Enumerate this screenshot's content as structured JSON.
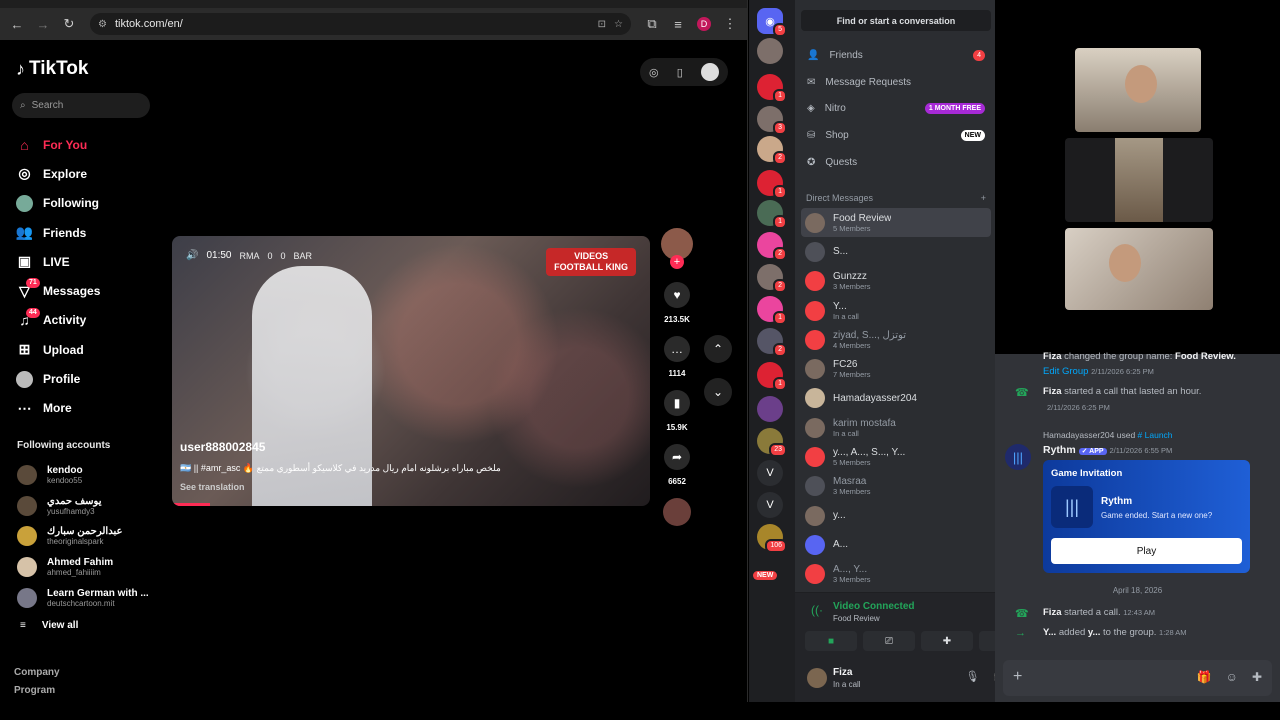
{
  "browser": {
    "url": "tiktok.com/en/",
    "profile_initial": "D"
  },
  "tiktok": {
    "logo": "TikTok",
    "search_placeholder": "Search",
    "nav": [
      {
        "label": "For You",
        "icon": "home-icon",
        "active": true
      },
      {
        "label": "Explore",
        "icon": "compass-icon"
      },
      {
        "label": "Following",
        "icon": "avatar-icon"
      },
      {
        "label": "Friends",
        "icon": "friends-icon"
      },
      {
        "label": "LIVE",
        "icon": "live-icon"
      },
      {
        "label": "Messages",
        "icon": "messages-icon",
        "badge": "71"
      },
      {
        "label": "Activity",
        "icon": "activity-icon",
        "badge": "44"
      },
      {
        "label": "Upload",
        "icon": "upload-icon"
      },
      {
        "label": "Profile",
        "icon": "profile-icon"
      },
      {
        "label": "More",
        "icon": "more-icon"
      }
    ],
    "following_title": "Following accounts",
    "following": [
      {
        "name": "kendoo",
        "user": "kendoo55"
      },
      {
        "name": "يوسف حمدي",
        "user": "yusufhamdy3"
      },
      {
        "name": "عبدالرحمن سبارك",
        "user": "theoriginalspark"
      },
      {
        "name": "Ahmed Fahim",
        "user": "ahmed_fahiiiim"
      },
      {
        "name": "Learn German with ...",
        "user": "deutschcartoon.mit"
      }
    ],
    "view_all": "View all",
    "footer": [
      "Company",
      "Program"
    ],
    "video": {
      "time": "01:50",
      "team1": "RMA",
      "score1": "0",
      "score2": "0",
      "team2": "BAR",
      "badge_line1": "VIDEOS",
      "badge_line2": "FOOTBALL KING",
      "username": "user888002845",
      "description": "ملخص مباراه برشلونه امام ريال مدريد في كلاسيكو أسطوري ممتع 🔥 🇦🇷 || #amr_asc",
      "translation": "See translation",
      "progress": 0.08
    },
    "actions": {
      "likes": "213.5K",
      "comments": "1114",
      "saves": "15.9K",
      "shares": "6652"
    }
  },
  "discord": {
    "server_badges": [
      "5",
      "",
      "1",
      "3",
      "2",
      "1",
      "1",
      "2",
      "2",
      "1",
      "2",
      "1",
      "",
      "23",
      "",
      "",
      "106"
    ],
    "server_new": "NEW",
    "search": "Find or start a conversation",
    "nav": [
      {
        "label": "Friends",
        "icon": "friends-icon",
        "badge": "4",
        "badge_type": "red"
      },
      {
        "label": "Message Requests",
        "icon": "mail-icon"
      },
      {
        "label": "Nitro",
        "icon": "nitro-icon",
        "badge": "1 MONTH FREE",
        "badge_type": "purple"
      },
      {
        "label": "Shop",
        "icon": "shop-icon",
        "badge": "NEW",
        "badge_type": "white"
      },
      {
        "label": "Quests",
        "icon": "quests-icon"
      }
    ],
    "dm_header": "Direct Messages",
    "dms": [
      {
        "name": "Food Review",
        "sub": "5 Members",
        "selected": true
      },
      {
        "name": "S...",
        "sub": ""
      },
      {
        "name": "Gunzzz",
        "sub": "3 Members"
      },
      {
        "name": "Y...",
        "sub": "In a call"
      },
      {
        "name": "ziyad, S..., توتزل",
        "sub": "4 Members",
        "dim": true
      },
      {
        "name": "FC26",
        "sub": "7 Members"
      },
      {
        "name": "Hamadayasser204",
        "sub": ""
      },
      {
        "name": "karim mostafa",
        "sub": "In a call",
        "dim": true
      },
      {
        "name": "y..., A..., S..., Y...",
        "sub": "5 Members"
      },
      {
        "name": "Masraa",
        "sub": "3 Members",
        "dim": true
      },
      {
        "name": "y...",
        "sub": ""
      },
      {
        "name": "A...",
        "sub": ""
      },
      {
        "name": "A..., Y...",
        "sub": "3 Members",
        "dim": true
      }
    ],
    "voice": {
      "title": "Video Connected",
      "sub": "Food Review"
    },
    "user": {
      "name": "Fiza",
      "status": "In a call"
    },
    "chat": {
      "msg1_user": "Fiza",
      "msg1_text": " changed the group name: ",
      "msg1_group": "Food Review.",
      "msg1_link": "Edit Group",
      "msg1_ts": "2/11/2026 6:25 PM",
      "msg2_user": "Fiza",
      "msg2_text": " started a call that lasted an hour.",
      "msg2_ts": "2/11/2026 6:25 PM",
      "reply_user": "Hamadayasser204",
      "reply_used": "used",
      "reply_cmd": "# Launch",
      "bot_name": "Rythm",
      "bot_tag": "✓ APP",
      "bot_ts": "2/11/2026 6:55 PM",
      "card_title": "Game Invitation",
      "card_name": "Rythm",
      "card_sub": "Game ended. Start a new one?",
      "card_button": "Play",
      "date_sep": "April 18, 2026",
      "msg3_user": "Fiza",
      "msg3_text": " started a call.",
      "msg3_ts": "12:43 AM",
      "msg4_user": "Y...",
      "msg4_text": " added ",
      "msg4_target": "y...",
      "msg4_text2": " to the group.",
      "msg4_ts": "1:28 AM"
    }
  }
}
